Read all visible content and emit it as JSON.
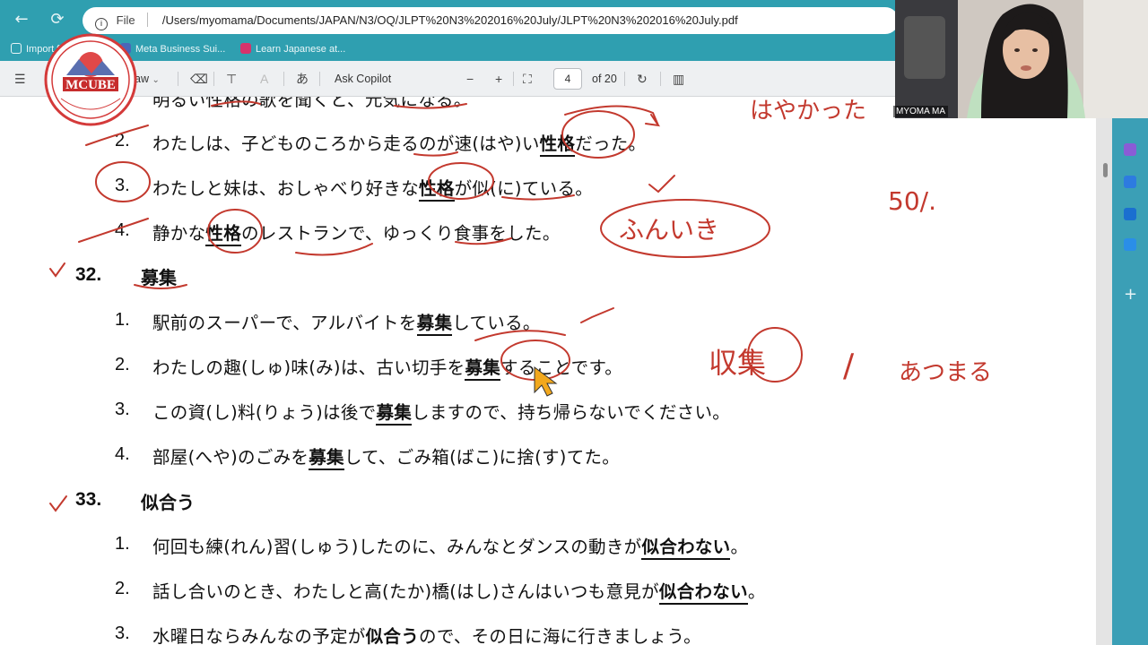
{
  "browser": {
    "back_icon": "arrow-left-icon",
    "reload_icon": "reload-icon",
    "file_label": "File",
    "url": "/Users/myomama/Documents/JAPAN/N3/OQ/JLPT%20N3%202016%20July/JLPT%20N3%202016%20July.pdf",
    "bookmarks": [
      {
        "label": "Import favorites"
      },
      {
        "label": "Meta Business Sui..."
      },
      {
        "label": "Learn Japanese at..."
      }
    ]
  },
  "pdf_toolbar": {
    "draw_label": "aw",
    "copilot_label": "Ask Copilot",
    "zoom_out": "−",
    "zoom_in": "+",
    "page_current": "4",
    "page_total": "of 20"
  },
  "logo": {
    "text": "MCUBE"
  },
  "document": {
    "q31_items": [
      {
        "num": "1.",
        "text": "明るい性格の歌を聞くと、元気になる。"
      },
      {
        "num": "2.",
        "pre": "わたしは、子どものころから走るのが速(はや)い",
        "kw": "性格",
        "post": "だった。"
      },
      {
        "num": "3.",
        "pre": "わたしと妹は、おしゃべり好きな",
        "kw": "性格",
        "post": "が似(に)ている。"
      },
      {
        "num": "4.",
        "pre": "静かな",
        "kw": "性格",
        "post": "のレストランで、ゆっくり食事をした。"
      }
    ],
    "q32": {
      "num": "32.",
      "word": "募集",
      "items": [
        {
          "num": "1.",
          "pre": "駅前のスーパーで、アルバイトを",
          "kw": "募集",
          "post": "している。"
        },
        {
          "num": "2.",
          "pre": "わたしの趣(しゅ)味(み)は、古い切手を",
          "kw": "募集",
          "post": "することです。"
        },
        {
          "num": "3.",
          "pre": "この資(し)料(りょう)は後で",
          "kw": "募集",
          "post": "しますので、持ち帰らないでください。"
        },
        {
          "num": "4.",
          "pre": "部屋(へや)のごみを",
          "kw": "募集",
          "post": "して、ごみ箱(ばこ)に捨(す)てた。"
        }
      ]
    },
    "q33": {
      "num": "33.",
      "word": "似合う",
      "items": [
        {
          "num": "1.",
          "pre": "何回も練(れん)習(しゅう)したのに、みんなとダンスの動きが",
          "kw": "似合わない",
          "post": "。"
        },
        {
          "num": "2.",
          "pre": "話し合いのとき、わたしと高(たか)橋(はし)さんはいつも意見が",
          "kw": "似合わない",
          "post": "。"
        },
        {
          "num": "3.",
          "pre": "水曜日ならみんなの予定が",
          "kw": "似合う",
          "post": "ので、その日に海に行きましょう。"
        }
      ]
    }
  },
  "annotations": {
    "hayakatta": "はやかった",
    "percent": "50/.",
    "fuiki": "ふんいき",
    "shushu": "収集",
    "slash": "/",
    "atsumaru": "あつまる"
  },
  "webcam": {
    "name": "MYOMA MA"
  },
  "colors": {
    "chrome": "#2f9fb0",
    "ink": "#c3392e",
    "edge_bar": "#3b9fb6"
  }
}
